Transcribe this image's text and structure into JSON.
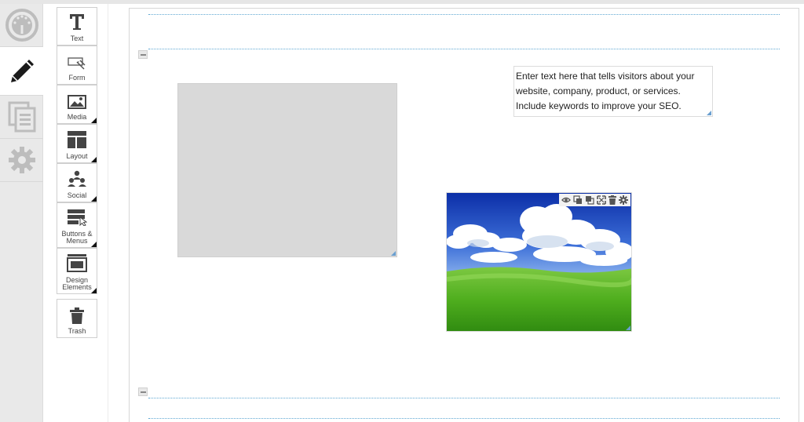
{
  "rail": {
    "items": [
      {
        "icon": "dashboard-icon",
        "active": false
      },
      {
        "icon": "pencil-icon",
        "active": true
      },
      {
        "icon": "pages-icon",
        "active": false
      },
      {
        "icon": "gear-icon",
        "active": false
      }
    ]
  },
  "palette": {
    "text_label": "Text",
    "form_label": "Form",
    "media_label": "Media",
    "layout_label": "Layout",
    "social_label": "Social",
    "buttons_label_1": "Buttons &",
    "buttons_label_2": "Menus",
    "design_label_1": "Design",
    "design_label_2": "Elements",
    "trash_label": "Trash"
  },
  "editor": {
    "text_block": "Enter text here that tells visitors about your website, company, product, or services. Include keywords to improve your SEO.",
    "image_toolbar_icons": [
      "eye-icon",
      "send-back-icon",
      "bring-front-icon",
      "expand-icon",
      "trash-icon",
      "gear-icon"
    ]
  },
  "colors": {
    "guide_line": "#5fa8d3",
    "resize_handle": "#6a9fd0",
    "rail_bg": "#e9e9e9"
  }
}
